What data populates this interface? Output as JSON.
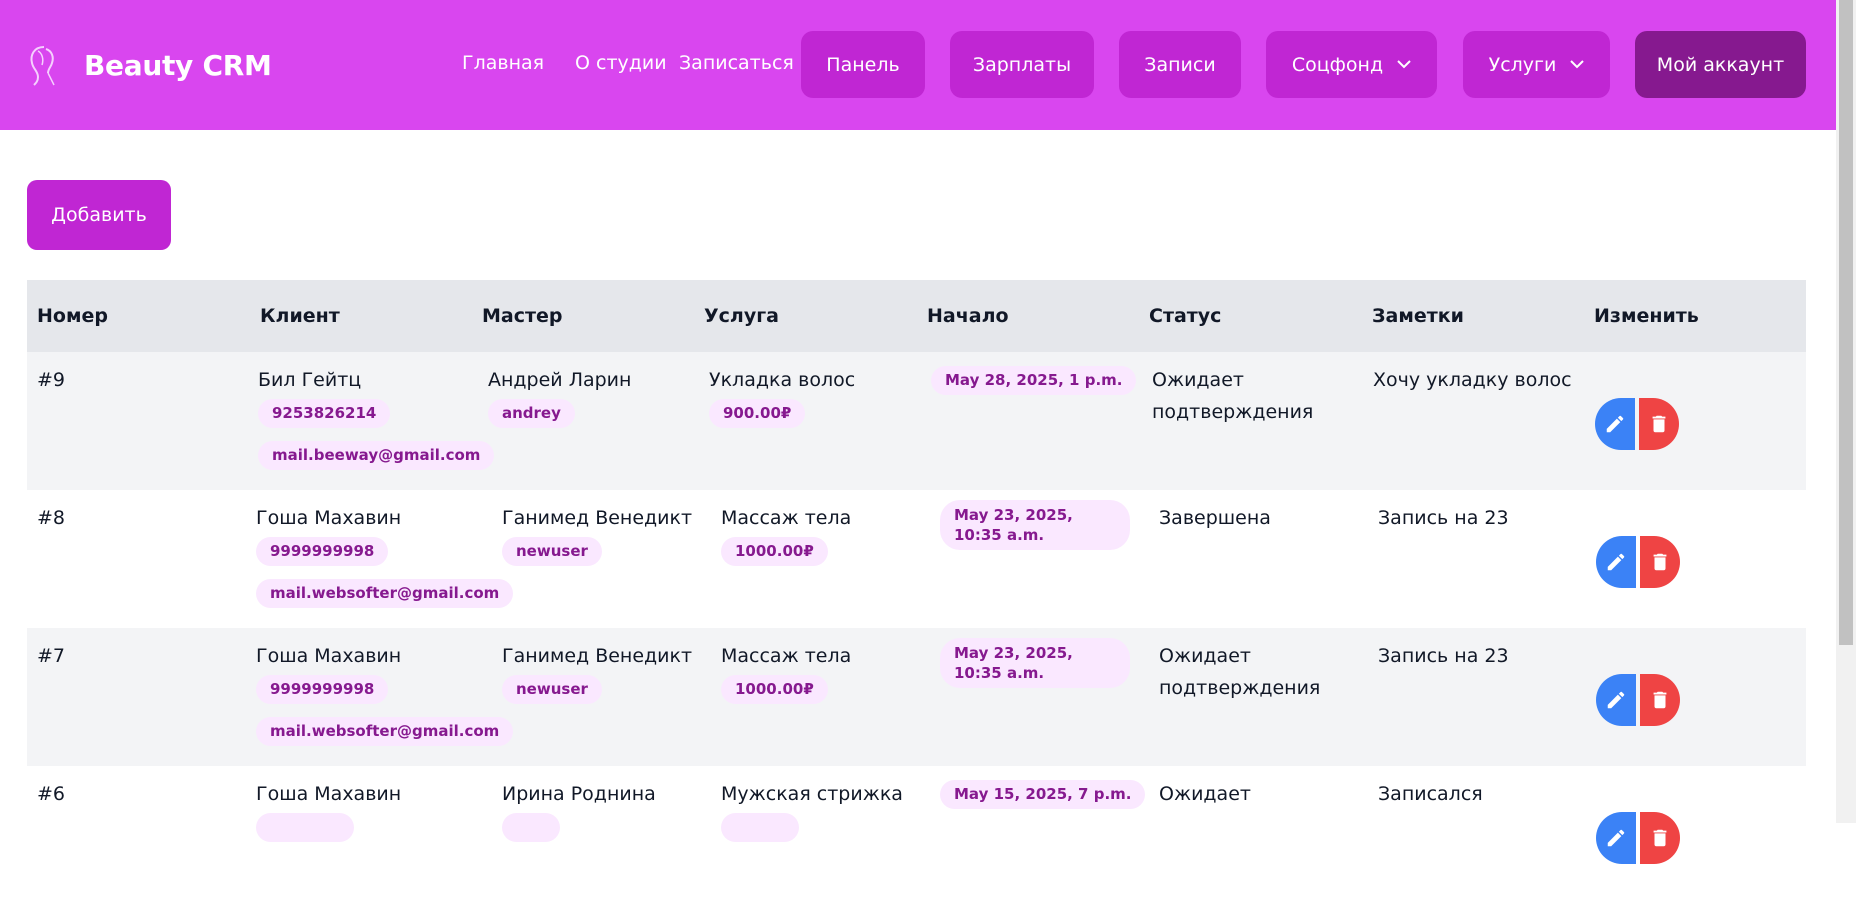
{
  "brand": {
    "title": "Beauty CRM",
    "logo": "woman-silhouette-logo"
  },
  "nav": {
    "links": [
      "Главная",
      "О студии",
      "Записаться"
    ],
    "buttons": {
      "panel": "Панель",
      "salaries": "Зарплаты",
      "records": "Записи",
      "socfund": "Соцфонд",
      "services": "Услуги",
      "account": "Мой аккаунт"
    }
  },
  "add_button": "Добавить",
  "table": {
    "headers": [
      "Номер",
      "Клиент",
      "Мастер",
      "Услуга",
      "Начало",
      "Статус",
      "Заметки",
      "Изменить"
    ],
    "rows": [
      {
        "number": "#9",
        "client": "Бил Гейтц",
        "phone": "9253826214",
        "email": "mail.beeway@gmail.com",
        "master": "Андрей Ларин",
        "master_login": "andrey",
        "service": "Укладка волос",
        "price": "900.00₽",
        "start": "May 28, 2025, 1 p.m.",
        "status": "Ожидает подтверждения",
        "notes": "Хочу укладку волос"
      },
      {
        "number": "#8",
        "client": "Гоша Махавин",
        "phone": "9999999998",
        "email": "mail.websofter@gmail.com",
        "master": "Ганимед Венедикт",
        "master_login": "newuser",
        "service": "Массаж тела",
        "price": "1000.00₽",
        "start": "May 23, 2025, 10:35 a.m.",
        "status": "Завершена",
        "notes": "Запись на 23"
      },
      {
        "number": "#7",
        "client": "Гоша Махавин",
        "phone": "9999999998",
        "email": "mail.websofter@gmail.com",
        "master": "Ганимед Венедикт",
        "master_login": "newuser",
        "service": "Массаж тела",
        "price": "1000.00₽",
        "start": "May 23, 2025, 10:35 a.m.",
        "status": "Ожидает подтверждения",
        "notes": "Запись на 23"
      },
      {
        "number": "#6",
        "client": "Гоша Махавин",
        "master": "Ирина Роднина",
        "service": "Мужская стрижка",
        "start": "May 15, 2025, 7 p.m.",
        "status": "Ожидает",
        "notes": "Записался"
      }
    ]
  },
  "colors": {
    "header": "#d946ef",
    "button": "#c026d3",
    "account_button": "#86198f",
    "pill_bg": "#fae8ff",
    "pill_text": "#86198f",
    "edit": "#3b82f6",
    "delete": "#ef4444"
  },
  "icons": {
    "edit": "pencil-icon",
    "delete": "trash-icon",
    "dropdown": "chevron-down-icon"
  }
}
